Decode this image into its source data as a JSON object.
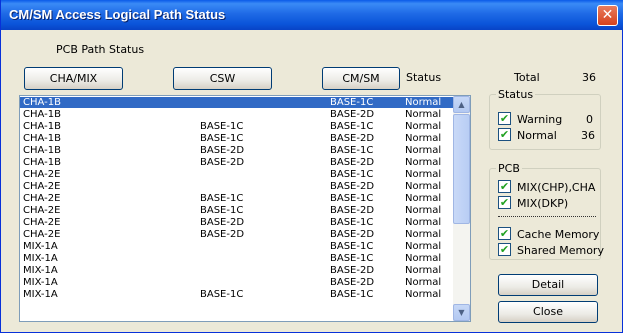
{
  "window": {
    "title": "CM/SM Access Logical Path Status",
    "close_glyph": "✕"
  },
  "section_label": "PCB Path Status",
  "columns": {
    "cha_mix": "CHA/MIX",
    "csw": "CSW",
    "cm_sm": "CM/SM",
    "status": "Status"
  },
  "rows": [
    {
      "cha": "CHA-1B",
      "csw": "",
      "cmsm": "BASE-1C",
      "status": "Normal"
    },
    {
      "cha": "CHA-1B",
      "csw": "",
      "cmsm": "BASE-2D",
      "status": "Normal"
    },
    {
      "cha": "CHA-1B",
      "csw": "BASE-1C",
      "cmsm": "BASE-1C",
      "status": "Normal"
    },
    {
      "cha": "CHA-1B",
      "csw": "BASE-1C",
      "cmsm": "BASE-2D",
      "status": "Normal"
    },
    {
      "cha": "CHA-1B",
      "csw": "BASE-2D",
      "cmsm": "BASE-1C",
      "status": "Normal"
    },
    {
      "cha": "CHA-1B",
      "csw": "BASE-2D",
      "cmsm": "BASE-2D",
      "status": "Normal"
    },
    {
      "cha": "CHA-2E",
      "csw": "",
      "cmsm": "BASE-1C",
      "status": "Normal"
    },
    {
      "cha": "CHA-2E",
      "csw": "",
      "cmsm": "BASE-2D",
      "status": "Normal"
    },
    {
      "cha": "CHA-2E",
      "csw": "BASE-1C",
      "cmsm": "BASE-1C",
      "status": "Normal"
    },
    {
      "cha": "CHA-2E",
      "csw": "BASE-1C",
      "cmsm": "BASE-2D",
      "status": "Normal"
    },
    {
      "cha": "CHA-2E",
      "csw": "BASE-2D",
      "cmsm": "BASE-1C",
      "status": "Normal"
    },
    {
      "cha": "CHA-2E",
      "csw": "BASE-2D",
      "cmsm": "BASE-2D",
      "status": "Normal"
    },
    {
      "cha": "MIX-1A",
      "csw": "",
      "cmsm": "BASE-1C",
      "status": "Normal"
    },
    {
      "cha": "MIX-1A",
      "csw": "",
      "cmsm": "BASE-1C",
      "status": "Normal"
    },
    {
      "cha": "MIX-1A",
      "csw": "",
      "cmsm": "BASE-2D",
      "status": "Normal"
    },
    {
      "cha": "MIX-1A",
      "csw": "",
      "cmsm": "BASE-2D",
      "status": "Normal"
    },
    {
      "cha": "MIX-1A",
      "csw": "BASE-1C",
      "cmsm": "BASE-1C",
      "status": "Normal"
    }
  ],
  "selected_row": 0,
  "total": {
    "label": "Total",
    "value": "36"
  },
  "status_group": {
    "title": "Status",
    "items": [
      {
        "label": "Warning",
        "count": "0",
        "checked": true
      },
      {
        "label": "Normal",
        "count": "36",
        "checked": true
      }
    ]
  },
  "pcb_group": {
    "title": "PCB",
    "items": [
      {
        "label": "MIX(CHP),CHA",
        "checked": true
      },
      {
        "label": "MIX(DKP)",
        "checked": true
      }
    ],
    "memory_items": [
      {
        "label": "Cache Memory",
        "checked": true
      },
      {
        "label": "Shared Memory",
        "checked": true
      }
    ]
  },
  "buttons": {
    "detail": "Detail",
    "close": "Close"
  },
  "check_glyph": "✔",
  "scroll_up_glyph": "▲",
  "scroll_down_glyph": "▼"
}
